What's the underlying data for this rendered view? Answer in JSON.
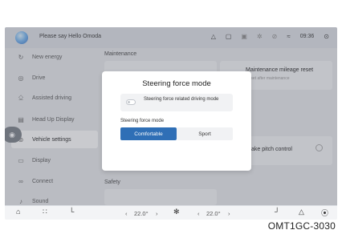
{
  "statusbar": {
    "assistant_prompt": "Please say Hello Omoda",
    "time": "09:36",
    "icons": [
      "a-icon",
      "screen-icon",
      "media-icon",
      "bluetooth-icon",
      "no-signal-icon",
      "signal-icon",
      "settings-icon"
    ]
  },
  "sidebar": {
    "items": [
      {
        "label": "New energy",
        "icon": "leaf-icon"
      },
      {
        "label": "Drive",
        "icon": "steering-icon"
      },
      {
        "label": "Assisted driving",
        "icon": "adas-icon"
      },
      {
        "label": "Head Up Display",
        "icon": "hud-icon"
      },
      {
        "label": "Vehicle settings",
        "icon": "car-icon"
      },
      {
        "label": "Display",
        "icon": "display-icon"
      },
      {
        "label": "Connect",
        "icon": "link-icon"
      },
      {
        "label": "Sound",
        "icon": "sound-icon"
      }
    ],
    "active_index": 4
  },
  "main": {
    "maintenance_title": "Maintenance",
    "maintenance_card_title": "Maintenance mileage reset",
    "maintenance_card_sub": "Reset after maintenance",
    "brake_card_title": "Brake pitch control",
    "safety_title": "Safety"
  },
  "dialog": {
    "title": "Steering force mode",
    "toggle_label": "Steering force related driving mode",
    "toggle_on": false,
    "mode_label": "Steering force mode",
    "options": [
      "Comfortable",
      "Sport"
    ],
    "selected": "Comfortable"
  },
  "dock": {
    "left_temp": "22.0°",
    "right_temp": "22.0°",
    "left_arrow": "‹",
    "right_arrow": "›"
  },
  "caption": "OMT1GC-3030",
  "colors": {
    "accent": "#2f6fb6",
    "background": "#e9ebee"
  }
}
